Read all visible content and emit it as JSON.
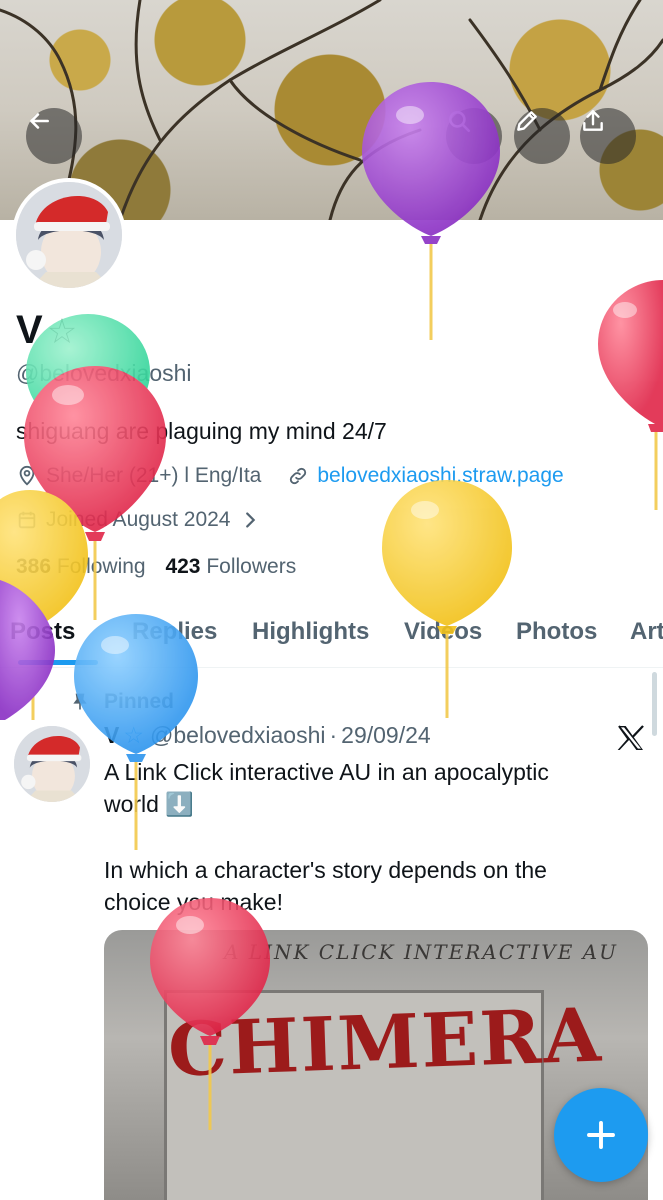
{
  "header": {
    "back_icon": "arrow-left-icon",
    "search_icon": "search-icon",
    "edit_icon": "pencil-icon",
    "share_icon": "share-icon"
  },
  "profile": {
    "name": "V",
    "name_badge": "☆",
    "handle": "@belovedxiaoshi",
    "bio": "shiguang are plaguing my mind 24/7",
    "location": "She/Her (21+) l Eng/Ita",
    "website": "belovedxiaoshi.straw.page",
    "joined": "Joined August 2024",
    "following_count": "386",
    "following_label": "Following",
    "followers_count": "423",
    "followers_label": "Followers"
  },
  "tabs": [
    {
      "label": "Posts",
      "active": true
    },
    {
      "label": "Replies"
    },
    {
      "label": "Highlights"
    },
    {
      "label": "Videos"
    },
    {
      "label": "Photos"
    },
    {
      "label": "Art"
    }
  ],
  "pinned_tweet": {
    "pinned_label": "Pinned",
    "author_name": "V",
    "author_badge": "☆",
    "author_handle": "@belovedxiaoshi",
    "separator": "·",
    "date": "29/09/24",
    "line1": "A Link Click interactive AU in an apocalyptic",
    "line2": "world ⬇️",
    "line3": "In which a character's story depends on the",
    "line4": "choice you make!",
    "media": {
      "subtitle": "A LINK CLICK INTERACTIVE AU",
      "title": "CHIMERA"
    }
  },
  "fab_icon": "plus-icon",
  "colors": {
    "accent": "#1d9bf0",
    "text_primary": "#0f1419",
    "text_secondary": "#536471"
  }
}
